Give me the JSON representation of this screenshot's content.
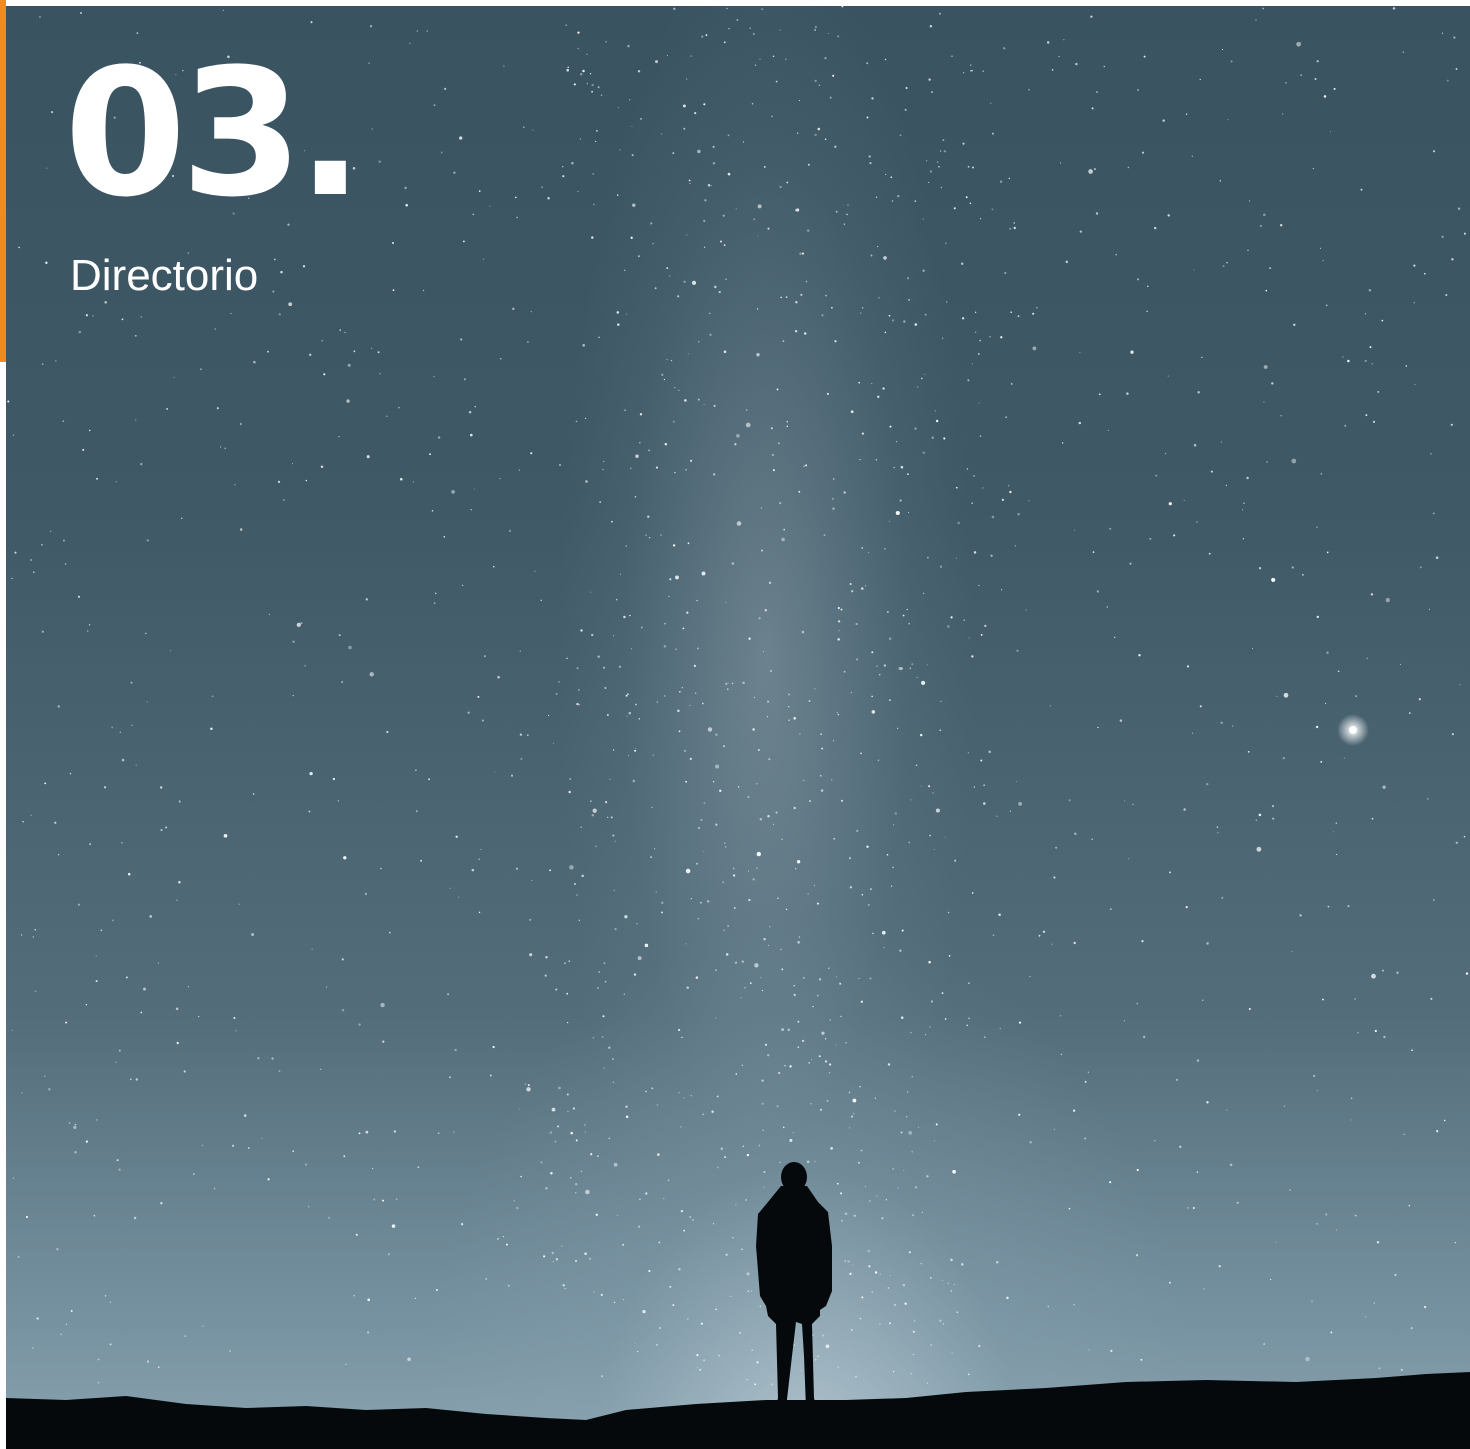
{
  "section": {
    "number": "03.",
    "title": "Directorio"
  },
  "colors": {
    "accent": "#f28a1e",
    "sky_top": "#3a5361",
    "sky_bottom": "#8aa3b0",
    "text": "#ffffff",
    "silhouette": "#06090b"
  }
}
